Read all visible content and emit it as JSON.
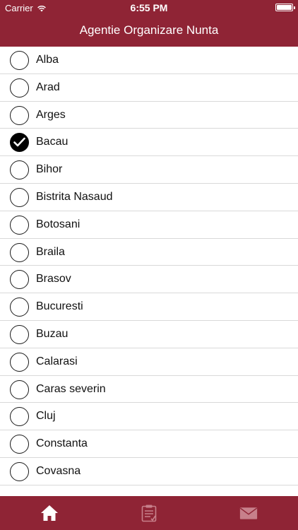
{
  "status_bar": {
    "carrier": "Carrier",
    "time": "6:55 PM",
    "wifi_icon": "wifi-icon",
    "battery_icon": "battery-icon"
  },
  "header": {
    "title": "Agentie Organizare Nunta"
  },
  "colors": {
    "brand": "#8f2435",
    "tab_inactive": "#c7808b",
    "tab_active": "#ffffff"
  },
  "list": {
    "items": [
      {
        "label": "Alba",
        "checked": false
      },
      {
        "label": "Arad",
        "checked": false
      },
      {
        "label": "Arges",
        "checked": false
      },
      {
        "label": "Bacau",
        "checked": true
      },
      {
        "label": "Bihor",
        "checked": false
      },
      {
        "label": "Bistrita Nasaud",
        "checked": false
      },
      {
        "label": "Botosani",
        "checked": false
      },
      {
        "label": "Braila",
        "checked": false
      },
      {
        "label": "Brasov",
        "checked": false
      },
      {
        "label": "Bucuresti",
        "checked": false
      },
      {
        "label": "Buzau",
        "checked": false
      },
      {
        "label": "Calarasi",
        "checked": false
      },
      {
        "label": "Caras severin",
        "checked": false
      },
      {
        "label": "Cluj",
        "checked": false
      },
      {
        "label": "Constanta",
        "checked": false
      },
      {
        "label": "Covasna",
        "checked": false
      },
      {
        "label": "",
        "checked": false
      }
    ]
  },
  "tabbar": {
    "tabs": [
      {
        "icon": "home-icon",
        "active": true
      },
      {
        "icon": "clipboard-icon",
        "active": false
      },
      {
        "icon": "mail-icon",
        "active": false
      }
    ]
  }
}
